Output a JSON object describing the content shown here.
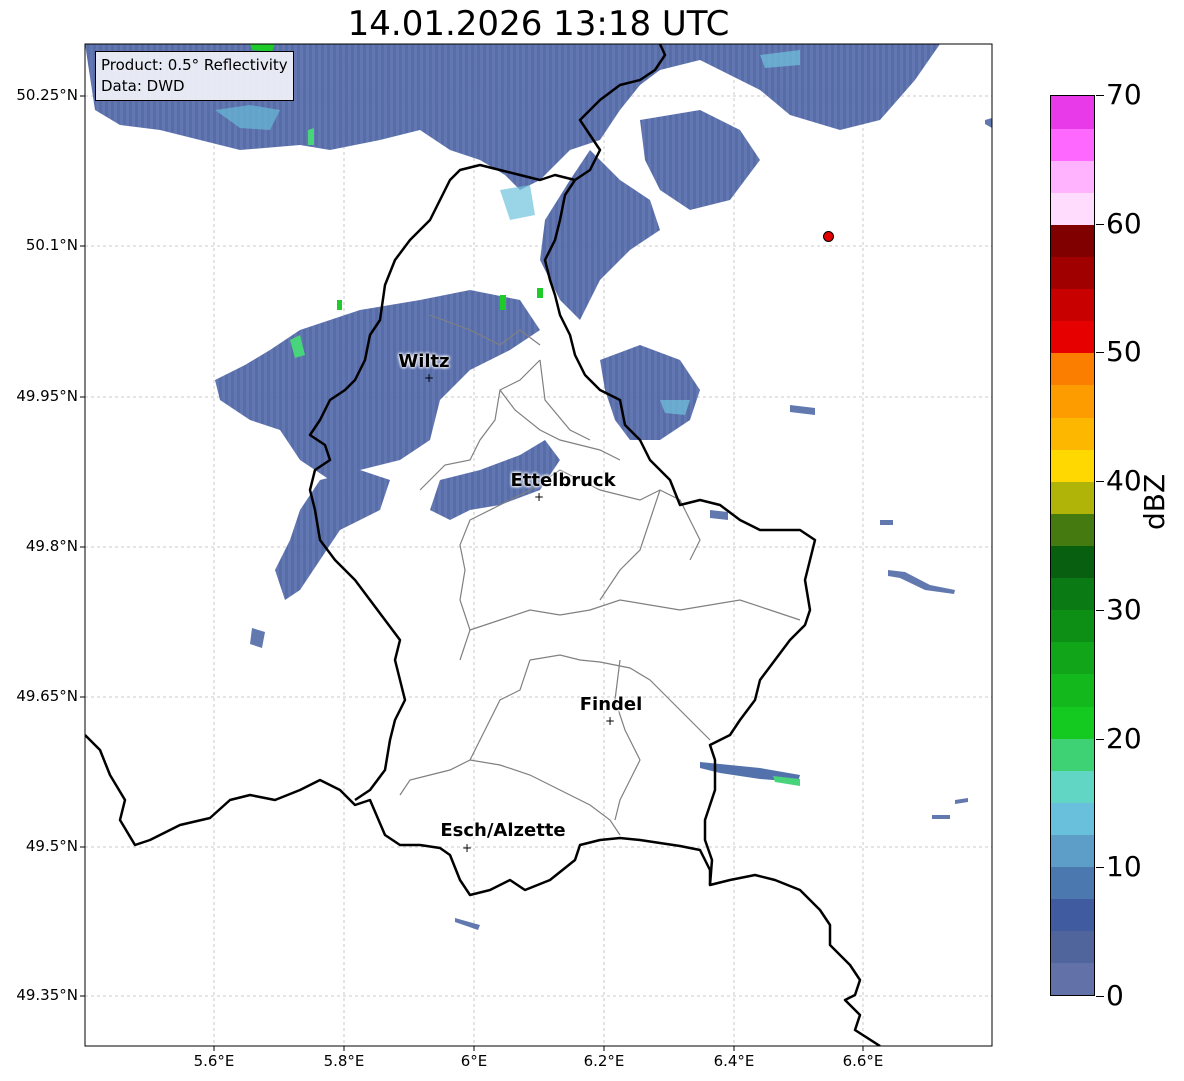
{
  "title": "14.01.2026 13:18 UTC",
  "info": {
    "product": "Product: 0.5° Reflectivity",
    "source": "Data: DWD"
  },
  "lat_labels": [
    "50.25°N",
    "50.1°N",
    "49.95°N",
    "49.8°N",
    "49.65°N",
    "49.5°N",
    "49.35°N"
  ],
  "lon_labels": [
    "5.6°E",
    "5.8°E",
    "6°E",
    "6.2°E",
    "6.4°E",
    "6.6°E"
  ],
  "cities": [
    {
      "name": "Wiltz"
    },
    {
      "name": "Ettelbruck"
    },
    {
      "name": "Findel"
    },
    {
      "name": "Esch/Alzette"
    }
  ],
  "colorbar": {
    "label": "dBZ",
    "ticks": [
      "0",
      "10",
      "20",
      "30",
      "40",
      "50",
      "60",
      "70"
    ],
    "colors": [
      "#6272a8",
      "#51659d",
      "#405ba0",
      "#4c78b0",
      "#5c9ec8",
      "#68c0dc",
      "#62d6c4",
      "#3fd274",
      "#14c91f",
      "#13b81c",
      "#11a519",
      "#0d8f16",
      "#0a7a14",
      "#085f10",
      "#457a10",
      "#b0b308",
      "#fed800",
      "#fdb700",
      "#fc9c00",
      "#fc7e00",
      "#e60000",
      "#c90000",
      "#a00000",
      "#800000",
      "#ffdbfe",
      "#ffb2fe",
      "#ff68ff",
      "#e83ae8"
    ]
  },
  "radar_site_marker": "red-circle"
}
